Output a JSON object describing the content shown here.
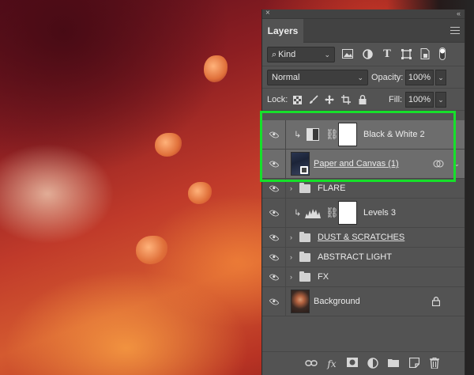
{
  "panel": {
    "close_glyph": "×",
    "collapse_glyph": "‹‹",
    "tab_label": "Layers"
  },
  "filter": {
    "kind_label": "Kind",
    "icons": [
      "image-filter-icon",
      "adjustment-filter-icon",
      "type-filter-icon",
      "shape-filter-icon",
      "smart-object-filter-icon",
      "filter-toggle-icon"
    ]
  },
  "blend": {
    "mode": "Normal",
    "opacity_label": "Opacity:",
    "opacity_value": "100%"
  },
  "lock": {
    "label": "Lock:",
    "fill_label": "Fill:",
    "fill_value": "100%"
  },
  "layers": [
    {
      "name": "Black & White 2",
      "type": "adjustment",
      "selected": true
    },
    {
      "name": "Paper and Canvas (1)",
      "type": "smart-object",
      "selected": true
    },
    {
      "name": "FLARE",
      "type": "group"
    },
    {
      "name": "Levels 3",
      "type": "adjustment"
    },
    {
      "name": "DUST & SCRATCHES",
      "type": "group"
    },
    {
      "name": "ABSTRACT LIGHT",
      "type": "group"
    },
    {
      "name": "FX",
      "type": "group"
    },
    {
      "name": "Background",
      "type": "background",
      "locked": true
    }
  ],
  "bottom_tools": [
    "link-layers-icon",
    "layer-style-icon",
    "add-mask-icon",
    "new-adjustment-icon",
    "new-group-icon",
    "new-layer-icon",
    "delete-layer-icon"
  ],
  "bottom_glyphs": {
    "fx": "fx"
  },
  "colors": {
    "panel_bg": "#535353",
    "selected_row": "#6d6d6d",
    "highlight": "#16e02a"
  }
}
